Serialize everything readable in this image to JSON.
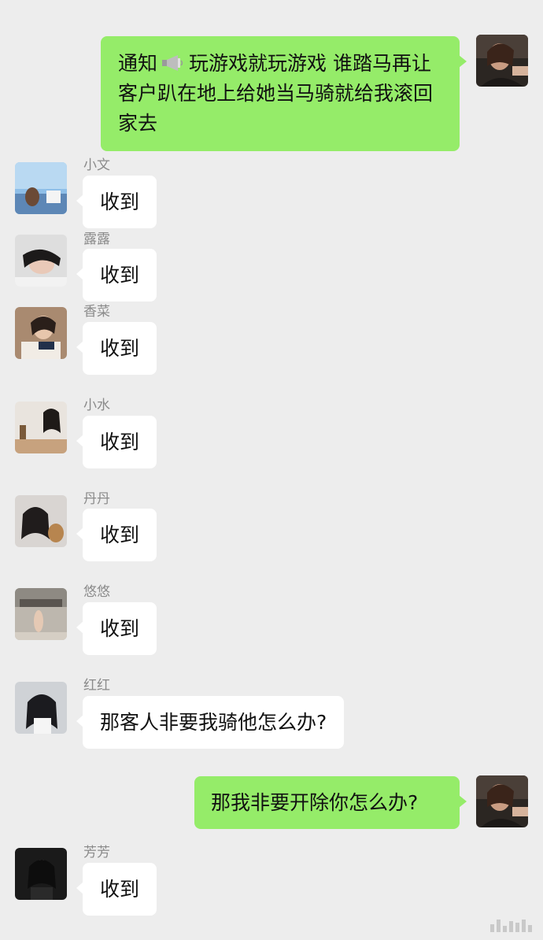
{
  "messages": [
    {
      "id": "m1",
      "direction": "out",
      "text_before_icon": "通知",
      "icon": "megaphone-icon",
      "text_after_icon": "玩游戏就玩游戏 谁踏马再让客户趴在地上给她当马骑就给我滚回家去"
    },
    {
      "id": "m2",
      "direction": "in",
      "sender": "小文",
      "text": "收到"
    },
    {
      "id": "m3",
      "direction": "in",
      "sender": "露露",
      "text": "收到"
    },
    {
      "id": "m4",
      "direction": "in",
      "sender": "香菜",
      "text": "收到"
    },
    {
      "id": "m5",
      "direction": "in",
      "sender": "小水",
      "text": "收到"
    },
    {
      "id": "m6",
      "direction": "in",
      "sender": "丹丹",
      "text": "收到"
    },
    {
      "id": "m7",
      "direction": "in",
      "sender": "悠悠",
      "text": "收到"
    },
    {
      "id": "m8",
      "direction": "in",
      "sender": "红红",
      "text": "那客人非要我骑他怎么办?"
    },
    {
      "id": "m9",
      "direction": "out",
      "text": "那我非要开除你怎么办?"
    },
    {
      "id": "m10",
      "direction": "in",
      "sender": "芳芳",
      "text": "收到"
    }
  ],
  "colors": {
    "background": "#ededed",
    "outgoing_bubble": "#95ec69",
    "incoming_bubble": "#ffffff",
    "sender_name": "#8a8a8a"
  }
}
